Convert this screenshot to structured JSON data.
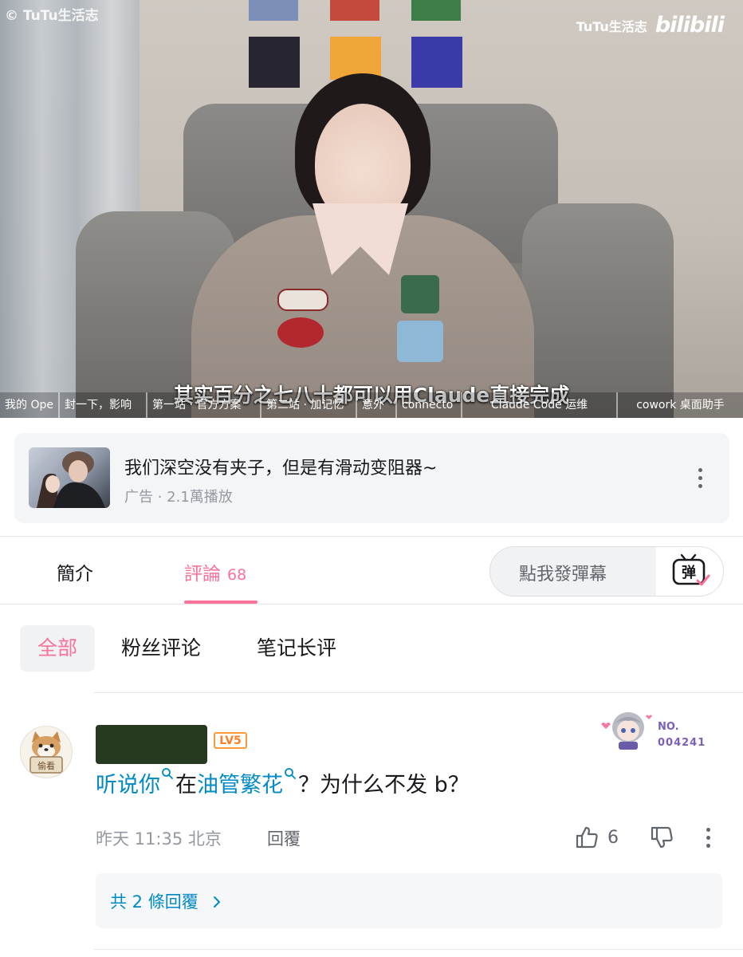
{
  "video": {
    "watermark_left": "© TuTu生活志",
    "watermark_channel": "TuTu生活志",
    "watermark_logo": "bilibili",
    "subtitle": "其实百分之七八十都可以用Claude直接完成",
    "chapters": [
      "我的 Ope",
      "封一下，影响",
      "第一站 · 官方方案",
      "第二站 · 加记忆",
      "意外",
      "connecto",
      "Claude Code 运维",
      "cowork 桌面助手"
    ]
  },
  "ad": {
    "title": "我们深空没有夹子，但是有滑动变阻器~",
    "meta": "广告 · 2.1萬播放",
    "more_icon": "more-vertical-icon"
  },
  "tabs": {
    "intro": "簡介",
    "comments": "評論",
    "comments_count": "68",
    "active": "comments"
  },
  "danmaku": {
    "placeholder": "點我發彈幕",
    "icon": "danmaku-tv-icon",
    "icon_text": "弹"
  },
  "sub_tabs": {
    "all": "全部",
    "fans": "粉丝评论",
    "notes": "笔记长评",
    "active": "all"
  },
  "comment": {
    "avatar_text": "偷看",
    "level": "LV5",
    "fan_badge_no": "NO.",
    "fan_badge_number": "004241",
    "text_link1": "听说你",
    "text_mid": "在",
    "text_link2": "油管繁花",
    "text_tail": "？为什么不发 b？",
    "time": "昨天 11:35 北京",
    "reply_label": "回覆",
    "likes": "6",
    "replies_label": "共 2 條回覆"
  },
  "colors": {
    "accent": "#fb7299",
    "link": "#008ac5",
    "level": "#ff9b3b",
    "muted": "#9499a0"
  }
}
